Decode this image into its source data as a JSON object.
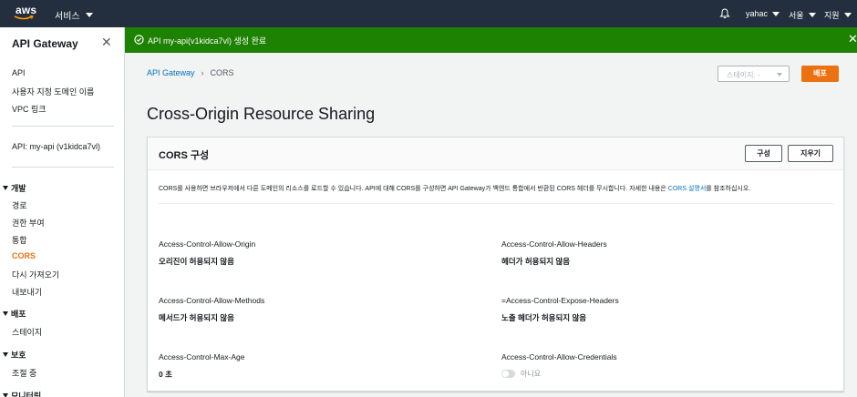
{
  "topnav": {
    "logo": "aws",
    "services_label": "서비스",
    "user_label": "yahac",
    "region_label": "서울",
    "support_label": "지원",
    "bell_icon": "bell-icon"
  },
  "sidebar": {
    "title": "API Gateway",
    "items": {
      "api": "API",
      "custom_domain": "사용자 지정 도메인 이름",
      "vpc_link": "VPC 링크",
      "api_name": "API: my-api (v1kidca7vl)"
    },
    "sections": {
      "develop": {
        "label": "개발",
        "items": [
          "경로",
          "권한 부여",
          "통합",
          "CORS",
          "다시 가져오기",
          "내보내기"
        ],
        "active": "CORS"
      },
      "deploy": {
        "label": "배포",
        "items": [
          "스테이지"
        ]
      },
      "protect": {
        "label": "보호",
        "items": [
          "조절 중"
        ]
      },
      "monitor": {
        "label": "모니터링"
      }
    }
  },
  "flash": {
    "message": "API my-api(v1kidca7vl) 생성 완료",
    "color": "#1d8102"
  },
  "breadcrumb": {
    "parent": "API Gateway",
    "current": "CORS"
  },
  "header": {
    "stage_select": "스테이지: -",
    "deploy_label": "배포",
    "title": "Cross-Origin Resource Sharing"
  },
  "panel": {
    "title": "CORS 구성",
    "configure_label": "구성",
    "clear_label": "지우기",
    "description": "CORS를 사용하면 브라우저에서 다른 도메인의 리소스를 로드할 수 있습니다. API에 대해 CORS를 구성하면 API Gateway가 백엔드 통합에서 반환된 CORS 헤더를 무시합니다. 자세한 내용은",
    "description_link": "CORS 설명서",
    "description_end": "를 참조하십시오.",
    "fields": {
      "allow_origin": {
        "label": "Access-Control-Allow-Origin",
        "value": "오리진이 허용되지 않음"
      },
      "allow_headers": {
        "label": "Access-Control-Allow-Headers",
        "value": "헤더가 허용되지 않음"
      },
      "allow_methods": {
        "label": "Access-Control-Allow-Methods",
        "value": "메서드가 허용되지 않음"
      },
      "expose_headers": {
        "label": "=Access-Control-Expose-Headers",
        "value": "노출 헤더가 허용되지 않음"
      },
      "max_age": {
        "label": "Access-Control-Max-Age",
        "value": "0 초"
      },
      "allow_credentials": {
        "label": "Access-Control-Allow-Credentials",
        "value": "아니요"
      }
    }
  },
  "colors": {
    "nav": "#232f3e",
    "accent": "#ec7211",
    "link": "#0073bb",
    "success": "#1d8102"
  }
}
